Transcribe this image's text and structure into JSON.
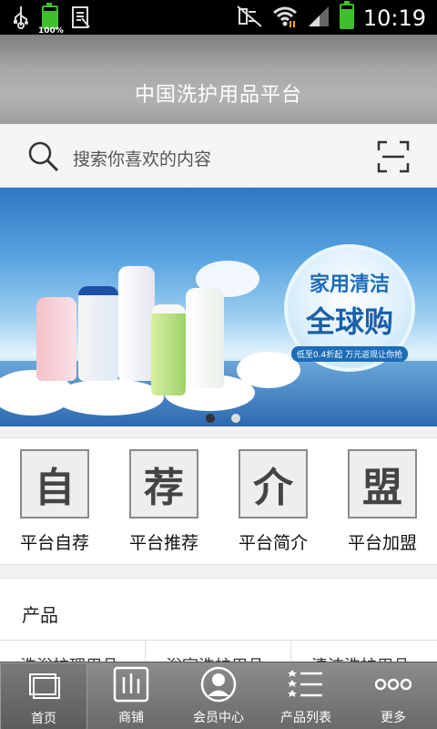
{
  "status_bar": {
    "time": "10:19",
    "battery_small_pct": "100%",
    "battery_level": 0.8
  },
  "header": {
    "title": "中国洗护用品平台"
  },
  "search": {
    "placeholder": "搜索你喜欢的内容"
  },
  "banner": {
    "headline_1": "家用清洁",
    "headline_2": "全球购",
    "tagline": "低至0.4折起 万元返现让你抢",
    "slide_count": 2,
    "active_slide": 1
  },
  "quick_nav": {
    "items": [
      {
        "icon_char": "自",
        "label": "平台自荐"
      },
      {
        "icon_char": "荐",
        "label": "平台推荐"
      },
      {
        "icon_char": "介",
        "label": "平台简介"
      },
      {
        "icon_char": "盟",
        "label": "平台加盟"
      }
    ]
  },
  "products": {
    "heading": "产品",
    "tabs": [
      {
        "label": "洗浴护理用品"
      },
      {
        "label": "浴室洗护用品"
      },
      {
        "label": "清洁洗护用品"
      }
    ]
  },
  "tab_bar": {
    "items": [
      {
        "label": "首页",
        "icon": "home-icon"
      },
      {
        "label": "商铺",
        "icon": "shop-icon"
      },
      {
        "label": "会员中心",
        "icon": "member-icon"
      },
      {
        "label": "产品列表",
        "icon": "list-icon"
      },
      {
        "label": "更多",
        "icon": "more-icon"
      }
    ]
  },
  "colors": {
    "battery_green": "#3fbf2c",
    "banner_blue": "#1d6cb7",
    "titlebar_gray": "#a8a8a8"
  }
}
